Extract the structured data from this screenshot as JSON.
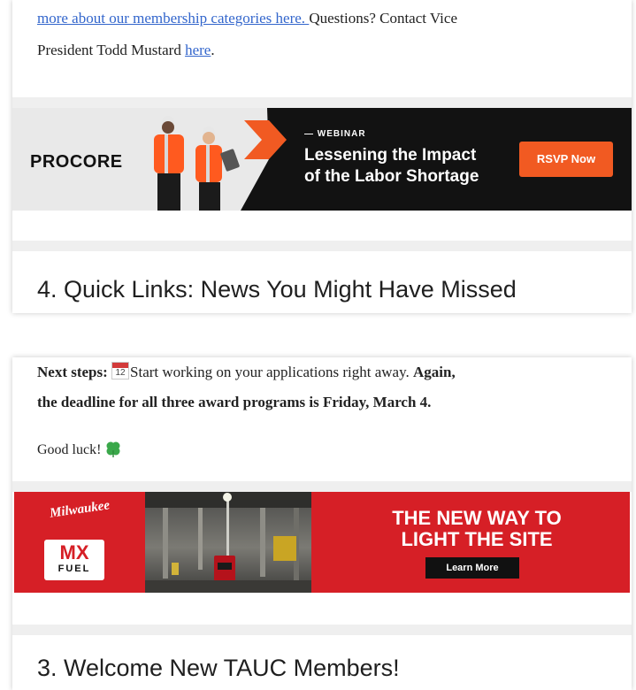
{
  "top_section": {
    "membership_link": "more about our membership categories here. ",
    "questions_text": " Questions? Contact Vice",
    "president_text": "President Todd Mustard ",
    "here_link": "here",
    "period": ".",
    "procore_ad": {
      "brand": "PROCORE",
      "label": "— WEBINAR",
      "title_line1": "Lessening the Impact",
      "title_line2": "of the Labor Shortage",
      "cta": "RSVP Now"
    },
    "heading": "4. Quick Links: News You Might Have Missed"
  },
  "bottom_section": {
    "next_steps_label": "Next steps: ",
    "calendar_icon_text": "12",
    "next_steps_text": "Start working on your applications right away. ",
    "deadline_bold": "Again,",
    "deadline_line2": "the deadline for all three award programs is Friday, March 4.",
    "good_luck": "Good luck! ",
    "milwaukee_ad": {
      "script_logo": "Milwaukee",
      "mx": "MX",
      "fuel": "FUEL",
      "headline_line1": "THE NEW WAY TO",
      "headline_line2": "LIGHT THE SITE",
      "cta": "Learn More"
    },
    "heading": "3. Welcome New TAUC Members!"
  },
  "colors": {
    "link": "#3366cc",
    "procore_orange": "#f15a22",
    "milwaukee_red": "#d61f26"
  }
}
